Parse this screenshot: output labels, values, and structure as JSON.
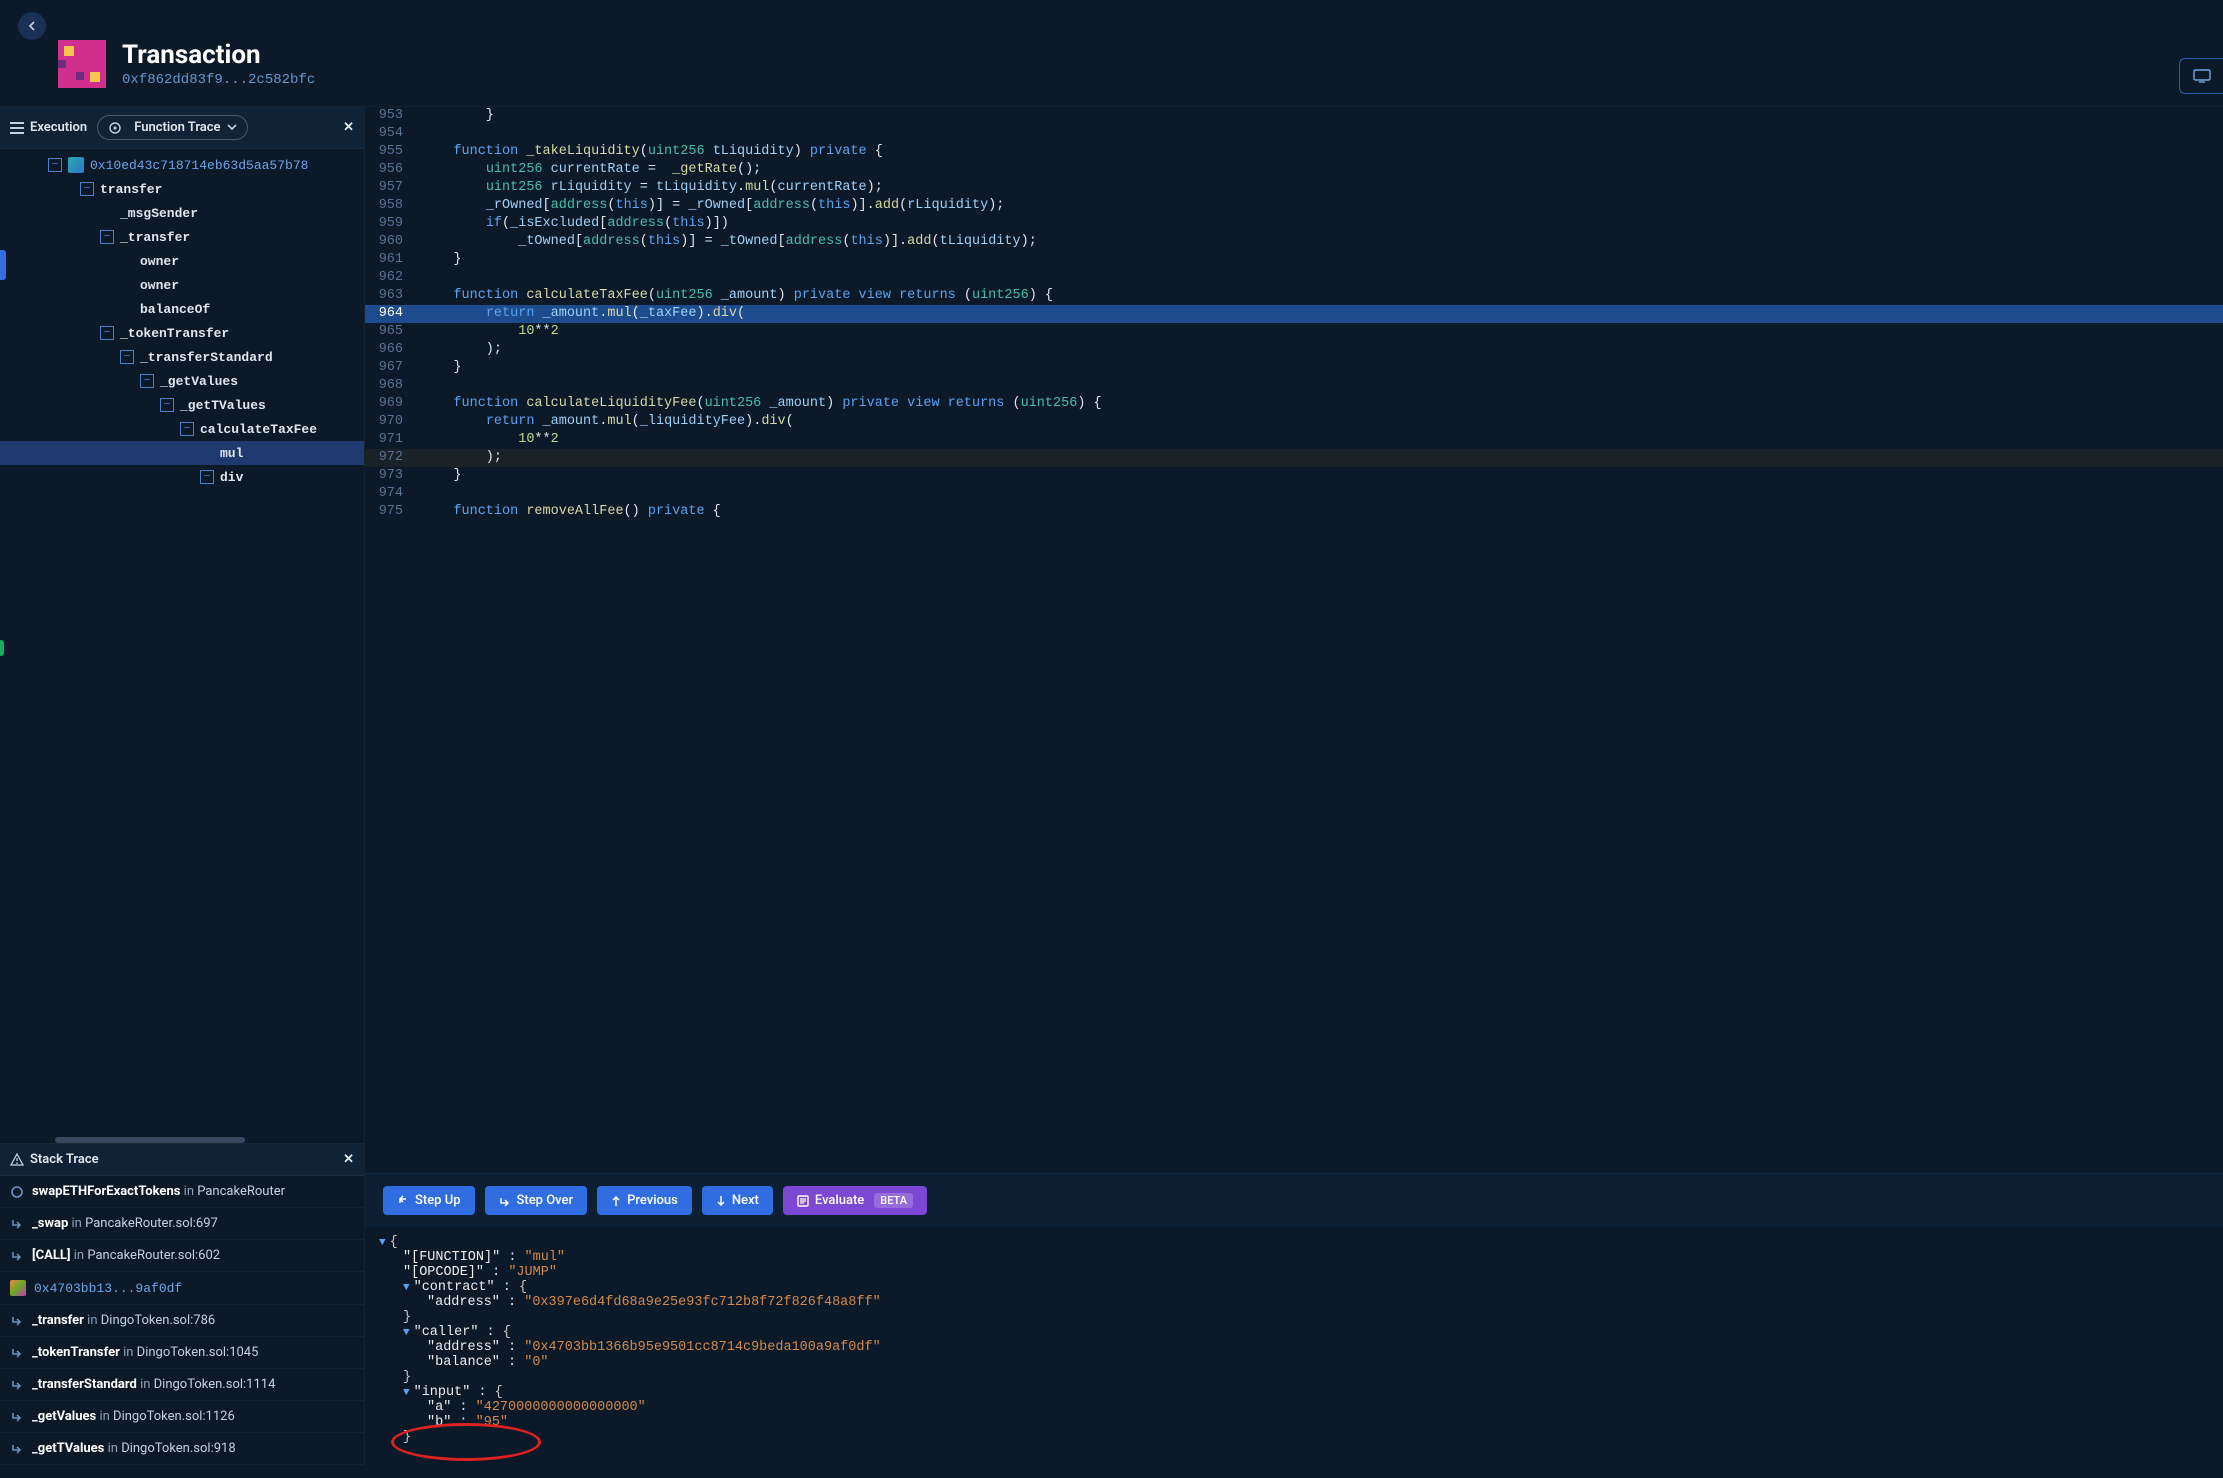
{
  "header": {
    "title": "Transaction",
    "hash": "0xf862dd83f9...2c582bfc"
  },
  "left": {
    "exec_label": "Execution",
    "trace_label": "Function Trace",
    "root_addr": "0x10ed43c718714eb63d5aa57b78",
    "tree": [
      {
        "lvl": 1,
        "tgl": true,
        "label": "transfer"
      },
      {
        "lvl": 2,
        "label": "_msgSender"
      },
      {
        "lvl": 2,
        "tgl": true,
        "label": "_transfer"
      },
      {
        "lvl": 3,
        "label": "owner"
      },
      {
        "lvl": 3,
        "label": "owner"
      },
      {
        "lvl": 3,
        "label": "balanceOf"
      },
      {
        "lvl": 2,
        "tgl": true,
        "label": "_tokenTransfer"
      },
      {
        "lvl": 3,
        "tgl": true,
        "label": "_transferStandard"
      },
      {
        "lvl": 4,
        "tgl": true,
        "label": "_getValues"
      },
      {
        "lvl": 5,
        "tgl": true,
        "label": "_getTValues"
      },
      {
        "lvl": 6,
        "tgl": true,
        "label": "calculateTaxFee"
      },
      {
        "lvl": 7,
        "label": "mul",
        "sel": true
      },
      {
        "lvl": 7,
        "tgl": true,
        "label": "div"
      }
    ]
  },
  "stack": {
    "title": "Stack Trace",
    "rows": [
      {
        "icon": "circle",
        "fn": "swapETHForExactTokens",
        "loc": "PancakeRouter"
      },
      {
        "icon": "arrow",
        "fn": "_swap",
        "loc": "PancakeRouter.sol:697"
      },
      {
        "icon": "arrow",
        "fn": "[CALL]",
        "loc": "PancakeRouter.sol:602"
      },
      {
        "icon": "pixel",
        "fn": "0x4703bb13...9af0df",
        "link": true
      },
      {
        "icon": "arrow",
        "fn": "_transfer",
        "loc": "DingoToken.sol:786"
      },
      {
        "icon": "arrow",
        "fn": "_tokenTransfer",
        "loc": "DingoToken.sol:1045"
      },
      {
        "icon": "arrow",
        "fn": "_transferStandard",
        "loc": "DingoToken.sol:1114"
      },
      {
        "icon": "arrow",
        "fn": "_getValues",
        "loc": "DingoToken.sol:1126"
      },
      {
        "icon": "arrow",
        "fn": "_getTValues",
        "loc": "DingoToken.sol:918"
      }
    ]
  },
  "code": {
    "start": 953,
    "hl": 964,
    "lines": [
      "        }",
      "",
      "    function _takeLiquidity(uint256 tLiquidity) private {",
      "        uint256 currentRate =  _getRate();",
      "        uint256 rLiquidity = tLiquidity.mul(currentRate);",
      "        _rOwned[address(this)] = _rOwned[address(this)].add(rLiquidity);",
      "        if(_isExcluded[address(this)])",
      "            _tOwned[address(this)] = _tOwned[address(this)].add(tLiquidity);",
      "    }",
      "",
      "    function calculateTaxFee(uint256 _amount) private view returns (uint256) {",
      "        return _amount.mul(_taxFee).div(",
      "            10**2",
      "        );",
      "    }",
      "",
      "    function calculateLiquidityFee(uint256 _amount) private view returns (uint256) {",
      "        return _amount.mul(_liquidityFee).div(",
      "            10**2",
      "        );",
      "    }",
      "",
      "    function removeAllFee() private {"
    ]
  },
  "dbg": {
    "stepup": "Step Up",
    "stepover": "Step Over",
    "prev": "Previous",
    "next": "Next",
    "eval": "Evaluate",
    "beta": "BETA"
  },
  "inspect": {
    "function": "mul",
    "opcode": "JUMP",
    "contract_address": "0x397e6d4fd68a9e25e93fc712b8f72f826f48a8ff",
    "caller_address": "0x4703bb1366b95e9501cc8714c9beda100a9af0df",
    "caller_balance": "0",
    "input_a": "4270000000000000000",
    "input_b": "95"
  }
}
